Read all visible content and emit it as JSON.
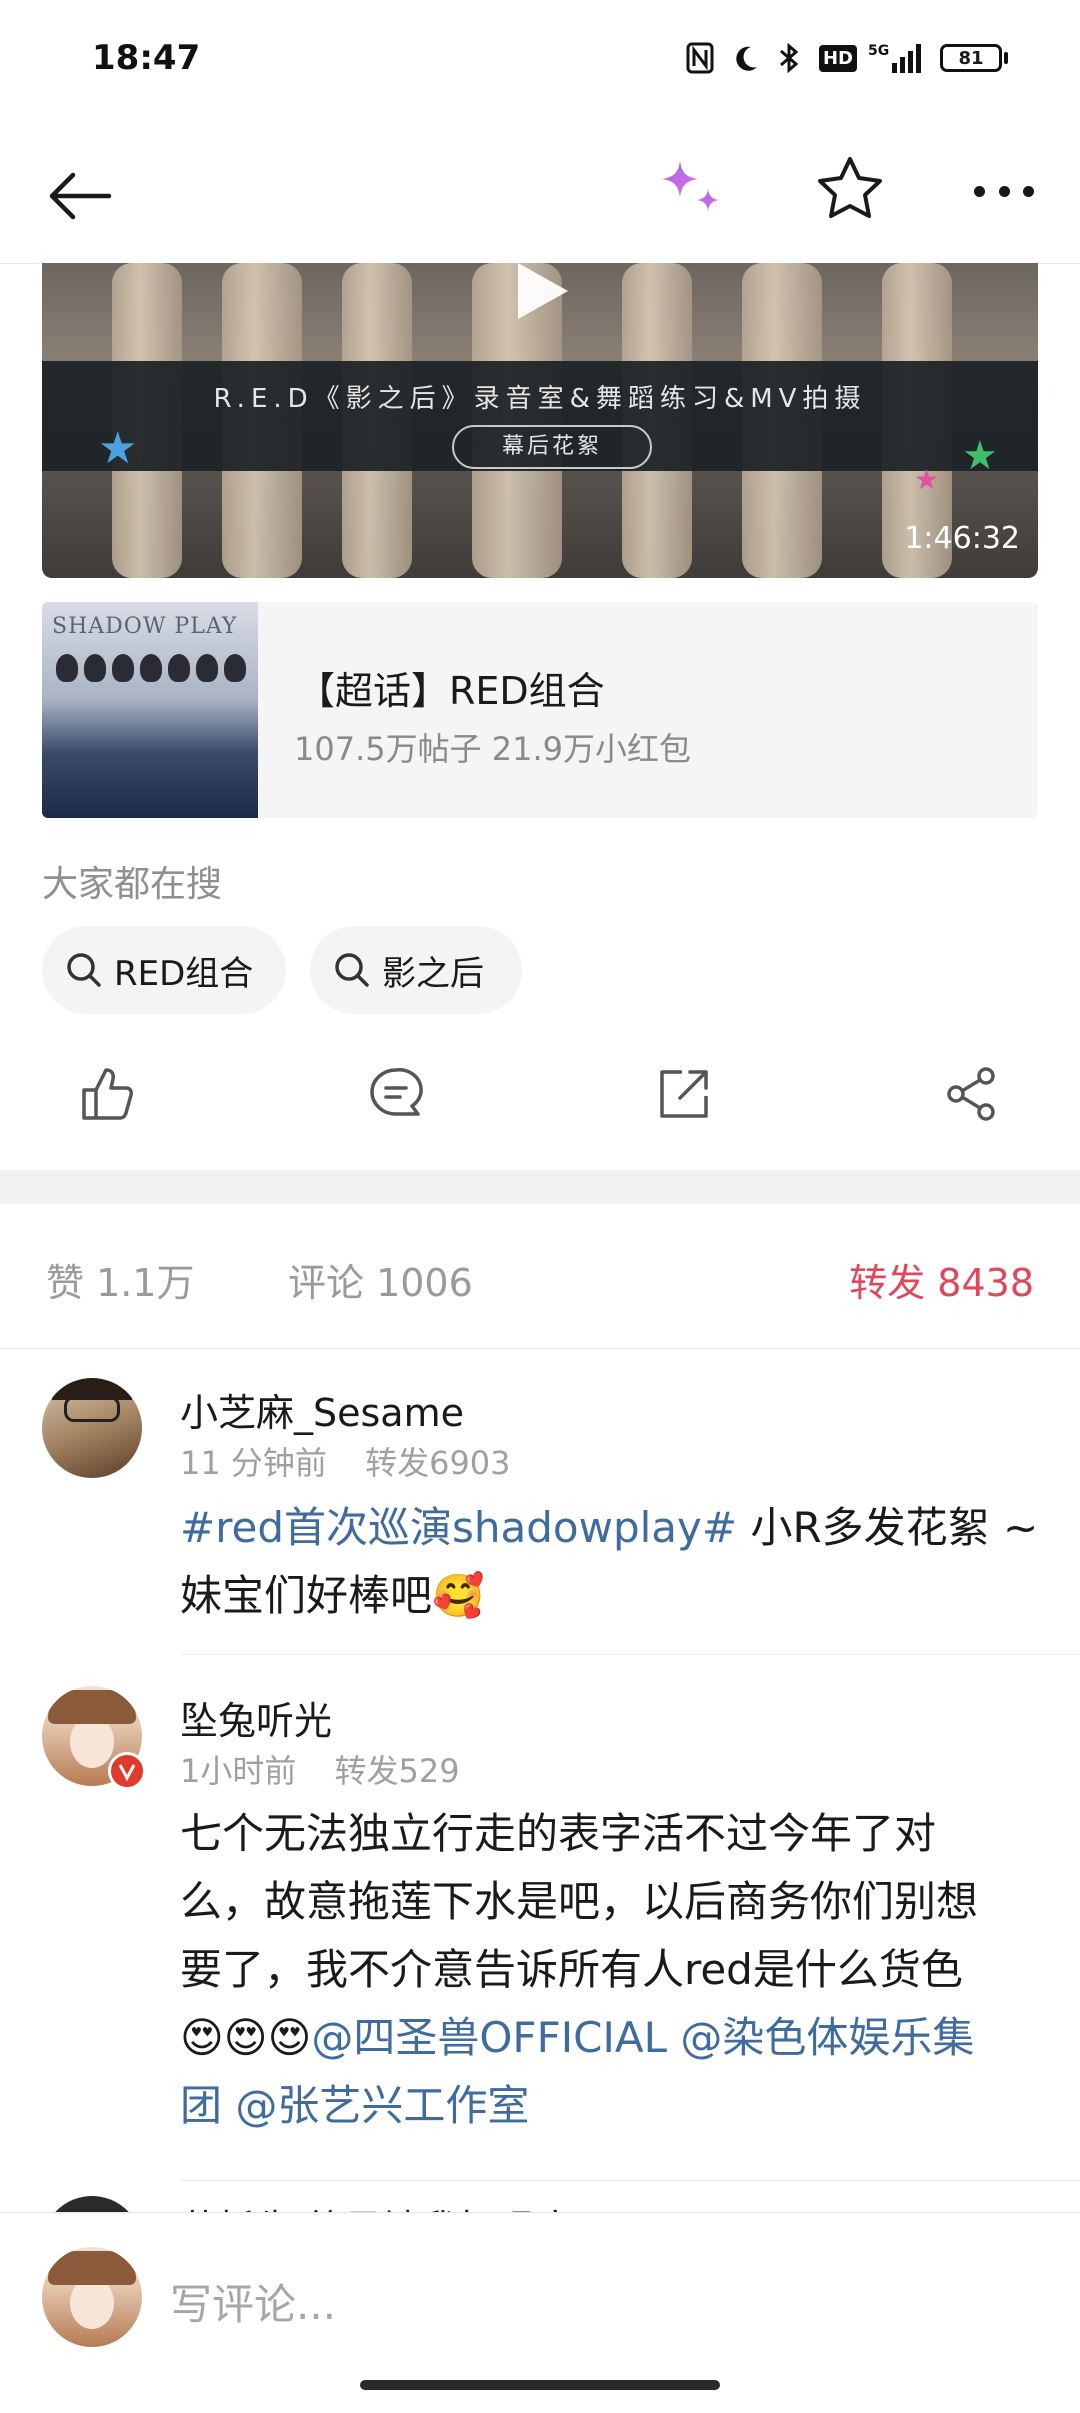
{
  "status_bar": {
    "time": "18:47",
    "battery": "81",
    "network": "5G"
  },
  "header": {
    "back_icon": "arrow-left-icon",
    "ai_icon": "sparkle-icon",
    "favorite_icon": "star-icon",
    "more_icon": "more-dots-icon"
  },
  "video": {
    "banner_title": "R.E.D《影之后》录音室&舞蹈练习&MV拍摄",
    "banner_pill": "幕后花絮",
    "duration": "1:46:32"
  },
  "topic": {
    "image_text": "SHADOW PLAY",
    "title": "【超话】RED组合",
    "subtitle": "107.5万帖子 21.9万小红包"
  },
  "search_section": {
    "title": "大家都在搜",
    "chips": [
      "RED组合",
      "影之后"
    ]
  },
  "stats": {
    "likes": "赞 1.1万",
    "comments": "评论 1006",
    "reposts": "转发 8438",
    "active_color": "#e0475b"
  },
  "comments": [
    {
      "name": "小芝麻_Sesame",
      "time": "11 分钟前",
      "reposts": "转发6903",
      "hashtag": "#red首次巡演shadowplay#",
      "text1": " 小R多发花絮 ~",
      "text2": "妹宝们好棒吧🥰"
    },
    {
      "name": "坠兔听光",
      "time": "1小时前",
      "reposts": "转发529",
      "line1": "七个无法独立行走的表字活不过今年了对",
      "line2": "么，故意拖莲下水是吧，以后商务你们别想",
      "line3": "要了，我不介意告诉所有人red是什么货色",
      "emoji": "😍😍😍",
      "mention1": "@四圣兽OFFICIAL",
      "mention2": " @染色体娱乐集",
      "mention3": "团 @张艺兴工作室"
    },
    {
      "name": "蓄托先 徐风被我扣眼疤"
    }
  ],
  "bottom_bar": {
    "placeholder": "写评论..."
  }
}
